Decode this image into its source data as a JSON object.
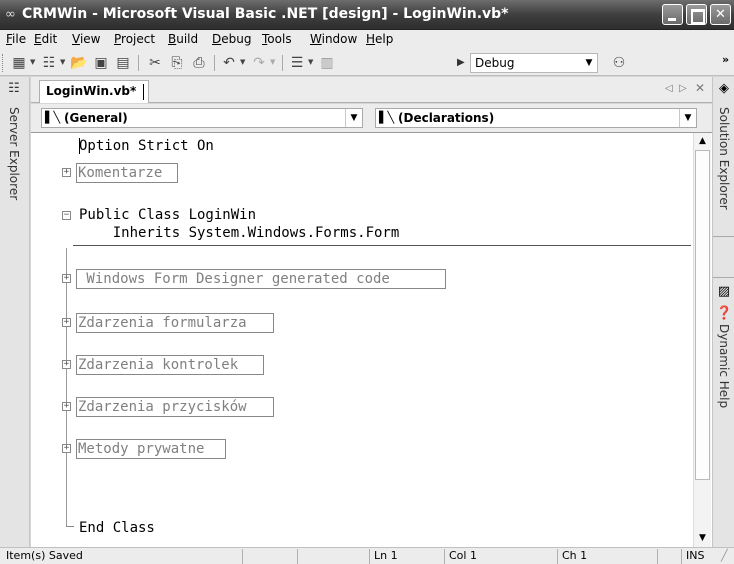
{
  "window": {
    "title": "CRMWin - Microsoft Visual Basic .NET [design] - LoginWin.vb*",
    "app_icon": "vs-icon"
  },
  "menu": [
    {
      "pre": "",
      "u": "F",
      "post": "ile"
    },
    {
      "pre": "",
      "u": "E",
      "post": "dit"
    },
    {
      "pre": "",
      "u": "V",
      "post": "iew"
    },
    {
      "pre": "",
      "u": "P",
      "post": "roject"
    },
    {
      "pre": "",
      "u": "B",
      "post": "uild"
    },
    {
      "pre": "",
      "u": "D",
      "post": "ebug"
    },
    {
      "pre": "",
      "u": "T",
      "post": "ools"
    },
    {
      "pre": "",
      "u": "W",
      "post": "indow"
    },
    {
      "pre": "",
      "u": "H",
      "post": "elp"
    }
  ],
  "toolbar": {
    "configuration": "Debug",
    "overflow": "»"
  },
  "left_dock": {
    "label": "Server Explorer"
  },
  "right_dock": {
    "solution_label": "Solution Explorer",
    "help_label": "Dynamic Help"
  },
  "document": {
    "tab_label": "LoginWin.vb*",
    "class_combo": "(General)",
    "method_combo": "(Declarations)"
  },
  "code_lines": {
    "option": "Option Strict On",
    "komentarze": "Komentarze",
    "class_decl": "Public Class LoginWin",
    "inherits": "    Inherits System.Windows.Forms.Form",
    "designer": " Windows Form Designer generated code ",
    "zd_formularza": "Zdarzenia formularza",
    "zd_kontrolek": "Zdarzenia kontrolek",
    "zd_przyciskow": "Zdarzenia przycisków",
    "metody": "Metody prywatne",
    "end_class": "End Class"
  },
  "status": {
    "message": "Item(s) Saved",
    "line": "Ln 1",
    "col": "Col 1",
    "ch": "Ch 1",
    "mode": "INS"
  },
  "colors": {
    "collapsed_region_text": "#808080",
    "title_bar": "#4a4a4a"
  }
}
